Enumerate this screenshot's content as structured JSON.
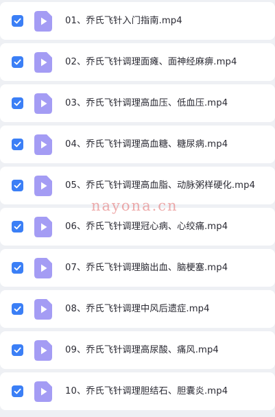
{
  "colors": {
    "checkbox": "#3b7ff6",
    "file_icon": "#a49cf4",
    "file_icon_play": "#ffffff",
    "row_background": "#ffffff",
    "page_background": "#eef0f4",
    "watermark": "#e47878"
  },
  "icons": {
    "checkbox": "checkmark-icon",
    "file": "video-file-icon"
  },
  "watermark": "nayona.cn",
  "files": [
    {
      "name": "01、乔氏飞针入门指南.mp4",
      "checked": true
    },
    {
      "name": "02、乔氏飞针调理面瘫、面神经麻痹.mp4",
      "checked": true
    },
    {
      "name": "03、乔氏飞针调理高血压、低血压.mp4",
      "checked": true
    },
    {
      "name": "04、乔氏飞针调理高血糖、糖尿病.mp4",
      "checked": true
    },
    {
      "name": "05、乔氏飞针调理高血脂、动脉粥样硬化.mp4",
      "checked": true
    },
    {
      "name": "06、乔氏飞针调理冠心病、心绞痛.mp4",
      "checked": true
    },
    {
      "name": "07、乔氏飞针调理脑出血、脑梗塞.mp4",
      "checked": true
    },
    {
      "name": "08、乔氏飞针调理中风后遗症.mp4",
      "checked": true
    },
    {
      "name": "09、乔氏飞针调理高尿酸、痛风.mp4",
      "checked": true
    },
    {
      "name": "10、乔氏飞针调理胆结石、胆囊炎.mp4",
      "checked": true
    }
  ]
}
